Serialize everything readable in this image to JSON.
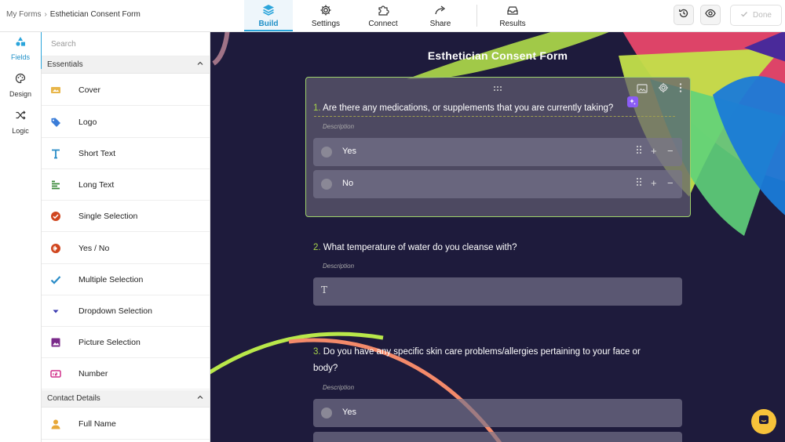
{
  "breadcrumb": {
    "root": "My Forms",
    "current": "Esthetician Consent Form"
  },
  "nav_tabs": [
    {
      "label": "Build",
      "icon": "layers-icon",
      "active": true
    },
    {
      "label": "Settings",
      "icon": "gear-icon",
      "active": false
    },
    {
      "label": "Connect",
      "icon": "puzzle-icon",
      "active": false
    },
    {
      "label": "Share",
      "icon": "share-arrow-icon",
      "active": false
    },
    {
      "label": "Results",
      "icon": "inbox-icon",
      "active": false
    }
  ],
  "toolbar": {
    "done_label": "Done"
  },
  "rail": [
    {
      "label": "Fields",
      "icon": "shapes-icon",
      "active": true
    },
    {
      "label": "Design",
      "icon": "palette-icon",
      "active": false
    },
    {
      "label": "Logic",
      "icon": "shuffle-icon",
      "active": false
    }
  ],
  "panel": {
    "search_placeholder": "Search",
    "sections": [
      {
        "title": "Essentials"
      },
      {
        "title": "Contact Details"
      }
    ],
    "essentials": [
      {
        "label": "Cover",
        "icon": "cover-image-icon",
        "color": "#e8b64a"
      },
      {
        "label": "Logo",
        "icon": "tag-icon",
        "color": "#3b7dd8"
      },
      {
        "label": "Short Text",
        "icon": "text-t-icon",
        "color": "#2a8cc7"
      },
      {
        "label": "Long Text",
        "icon": "paragraph-lines-icon",
        "color": "#3a8a3a"
      },
      {
        "label": "Single Selection",
        "icon": "check-circle-icon",
        "color": "#d0461f"
      },
      {
        "label": "Yes / No",
        "icon": "yes-no-icon",
        "color": "#d0461f"
      },
      {
        "label": "Multiple Selection",
        "icon": "checkmark-icon",
        "color": "#2a8cc7"
      },
      {
        "label": "Dropdown Selection",
        "icon": "caret-down-icon",
        "color": "#3a3ab0"
      },
      {
        "label": "Picture Selection",
        "icon": "picture-icon",
        "color": "#7a2a8a"
      },
      {
        "label": "Number",
        "icon": "number-icon",
        "color": "#d0308a"
      }
    ],
    "contact": [
      {
        "label": "Full Name",
        "icon": "person-icon",
        "color": "#e8a838"
      }
    ]
  },
  "form": {
    "title": "Esthetician Consent Form",
    "questions": [
      {
        "num": "1.",
        "text": "Are there any medications, or supplements that you are currently taking?",
        "description": "Description",
        "options": [
          "Yes",
          "No"
        ]
      },
      {
        "num": "2.",
        "text": "What temperature of water do you cleanse with?",
        "description": "Description",
        "input_glyph": "T"
      },
      {
        "num": "3.",
        "text": "Do you have any specific skin care problems/allergies pertaining to your face or body?",
        "description": "Description",
        "options": [
          "Yes"
        ]
      }
    ]
  },
  "colors": {
    "accent": "#2ba5db",
    "canvas_bg": "#1e1b3c",
    "selected_border": "#9fd36a",
    "number_color": "#a7d44a",
    "chat_button": "#f7c23a",
    "ai_badge": "#8b5cf6"
  }
}
